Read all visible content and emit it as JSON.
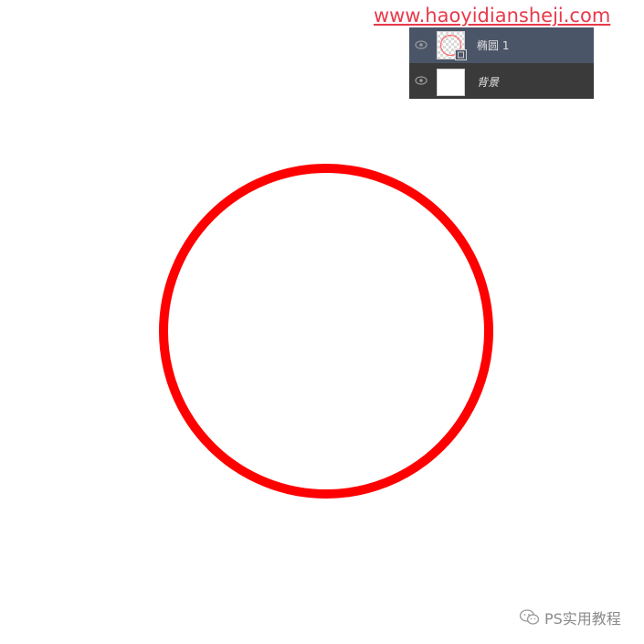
{
  "watermark": {
    "url_text": "www.haoyidiansheji.com"
  },
  "layers_panel": {
    "layers": [
      {
        "name": "椭圆 1",
        "visible": true,
        "selected": true,
        "thumbnail": "transparent-checker",
        "badge": "shape-layer-icon"
      },
      {
        "name": "背景",
        "visible": true,
        "selected": false,
        "thumbnail": "white-fill"
      }
    ]
  },
  "canvas": {
    "shape": "circle",
    "stroke_color": "#ff0000",
    "fill": "none"
  },
  "footer": {
    "account_label": "PS实用教程",
    "icon": "wechat-icon"
  }
}
